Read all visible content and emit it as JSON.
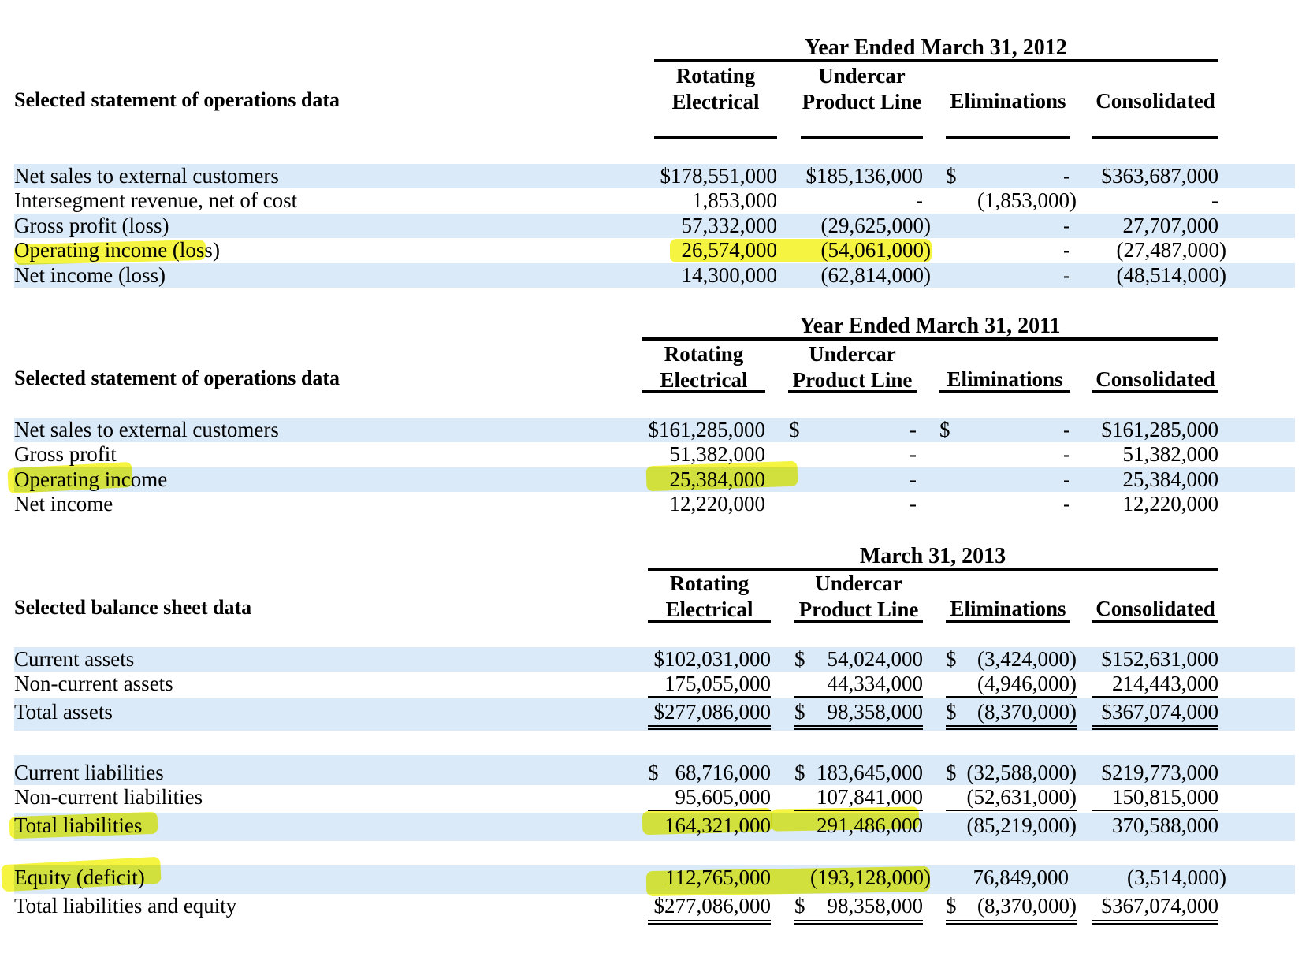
{
  "sections": [
    {
      "period": "Year Ended March 31, 2012",
      "title": "Selected statement of operations data",
      "columns": [
        "Rotating Electrical",
        "Undercar Product Line",
        "Eliminations",
        "Consolidated"
      ],
      "rows": [
        {
          "label": "Net sales to external customers",
          "cells": [
            "$178,551,000",
            "$185,136,000",
            "$",
            "-",
            "$363,687,000"
          ]
        },
        {
          "label": "Intersegment revenue, net of cost",
          "cells": [
            "1,853,000",
            "-",
            "(1,853,000)",
            "-"
          ]
        },
        {
          "label": "Gross profit (loss)",
          "cells": [
            "57,332,000",
            "(29,625,000)",
            "-",
            "27,707,000"
          ]
        },
        {
          "label": "Operating income (loss)",
          "cells": [
            "26,574,000",
            "(54,061,000)",
            "-",
            "(27,487,000)"
          ]
        },
        {
          "label": "Net income (loss)",
          "cells": [
            "14,300,000",
            "(62,814,000)",
            "-",
            "(48,514,000)"
          ]
        }
      ]
    },
    {
      "period": "Year Ended March 31, 2011",
      "title": "Selected statement of operations data",
      "columns": [
        "Rotating Electrical",
        "Undercar Product Line",
        "Eliminations",
        "Consolidated"
      ],
      "rows": [
        {
          "label": "Net sales to external customers",
          "cells": [
            "$161,285,000",
            "$",
            "-",
            "$",
            "-",
            "$161,285,000"
          ]
        },
        {
          "label": "Gross profit",
          "cells": [
            "51,382,000",
            "-",
            "-",
            "51,382,000"
          ]
        },
        {
          "label": "Operating income",
          "cells": [
            "25,384,000",
            "-",
            "-",
            "25,384,000"
          ]
        },
        {
          "label": "Net income",
          "cells": [
            "12,220,000",
            "-",
            "-",
            "12,220,000"
          ]
        }
      ]
    },
    {
      "period": "March 31, 2013",
      "title": "Selected balance sheet data",
      "columns": [
        "Rotating Electrical",
        "Undercar Product Line",
        "Eliminations",
        "Consolidated"
      ],
      "rows": [
        {
          "label": "Current assets",
          "cells": [
            "$102,031,000",
            "$",
            "54,024,000",
            "$",
            "(3,424,000)",
            "$152,631,000"
          ]
        },
        {
          "label": "Non-current assets",
          "cells": [
            "175,055,000",
            "44,334,000",
            "(4,946,000)",
            "214,443,000"
          ]
        },
        {
          "label": "Total assets",
          "cells": [
            "$277,086,000",
            "$",
            "98,358,000",
            "$",
            "(8,370,000)",
            "$367,074,000"
          ]
        },
        {
          "label": "Current liabilities",
          "cells": [
            "$",
            "68,716,000",
            "$",
            "183,645,000",
            "$",
            "(32,588,000)",
            "$219,773,000"
          ]
        },
        {
          "label": "Non-current liabilities",
          "cells": [
            "95,605,000",
            "107,841,000",
            "(52,631,000)",
            "150,815,000"
          ]
        },
        {
          "label": "Total liabilities",
          "cells": [
            "164,321,000",
            "291,486,000",
            "(85,219,000)",
            "370,588,000"
          ]
        },
        {
          "label": "Equity (deficit)",
          "cells": [
            "112,765,000",
            "(193,128,000)",
            "76,849,000",
            "(3,514,000)"
          ]
        },
        {
          "label": "Total liabilities and equity",
          "cells": [
            "$277,086,000",
            "$",
            "98,358,000",
            "$",
            "(8,370,000)",
            "$367,074,000"
          ]
        }
      ]
    }
  ],
  "colors": {
    "row_band": "#dbeaf8",
    "highlight": "#f2f000"
  }
}
